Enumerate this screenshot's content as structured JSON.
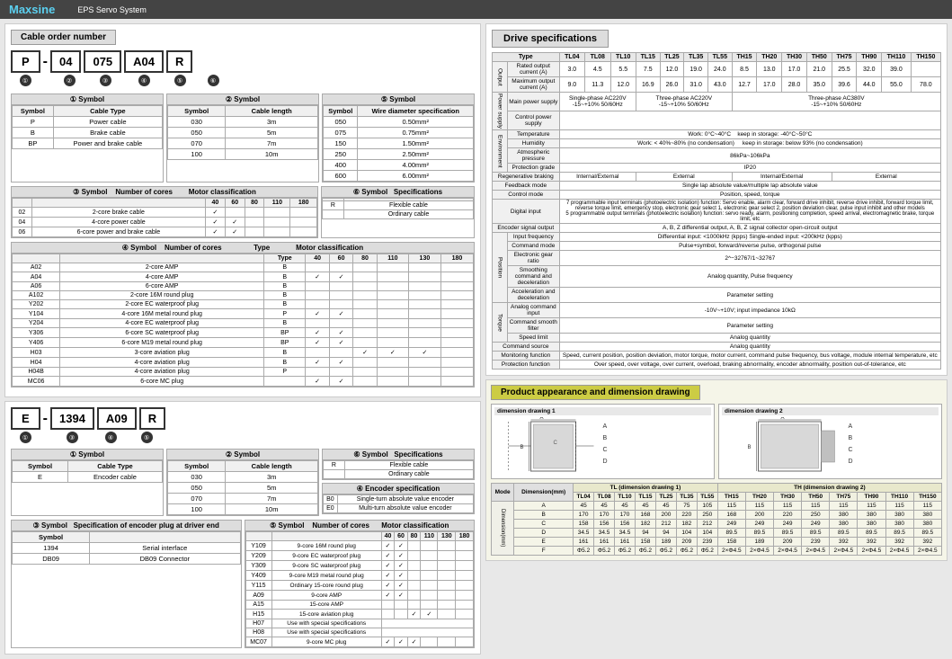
{
  "header": {
    "logo": "Maxsine",
    "system": "EPS Servo System"
  },
  "cable_order": {
    "title": "Cable order number",
    "code1": {
      "parts": [
        "P",
        "-",
        "04",
        "075",
        "A04",
        "R"
      ],
      "numbers": [
        "①",
        "②",
        "③",
        "④",
        "⑤",
        "⑥"
      ]
    },
    "code2": {
      "parts": [
        "E",
        "-",
        "1394",
        "A09",
        "R"
      ],
      "numbers": [
        "①",
        "②",
        "③",
        "④",
        "⑤"
      ]
    }
  },
  "drive_spec": {
    "title": "Drive specifications",
    "type_row": [
      "Type",
      "TL04",
      "TL08",
      "TL10",
      "TL15",
      "TL25",
      "TL35",
      "TL55",
      "TH15",
      "TH20",
      "TH30",
      "TH50",
      "TH75",
      "TH90",
      "TH110",
      "TH150"
    ],
    "rated_output": {
      "label": "Rated output current (A)",
      "values": [
        "3.0",
        "4.5",
        "5.5",
        "7.5",
        "12.0",
        "19.0",
        "24.0",
        "8.5",
        "13.0",
        "17.0",
        "21.0",
        "25.5",
        "32.0",
        "39.0",
        ""
      ]
    },
    "max_output": {
      "label": "Maximum output current (A)",
      "values": [
        "9.0",
        "11.3",
        "12.0",
        "16.9",
        "26.0",
        "31.0",
        "43.0",
        "12.7",
        "17.0",
        "28.0",
        "35.0",
        "39.6",
        "44.0",
        "55.0",
        "78.0"
      ]
    },
    "power_supply": {
      "label": "Main power supply",
      "single": "Single-phase AC220V -15~+10% 50/60Hz",
      "three_low": "Three-phase AC220V -15~+10% 50/60Hz",
      "three_high": "Three-phase AC380V -15~+10% 50/60Hz"
    },
    "environment": {
      "temp": "Work: 0°C~40°C   keep in storage: -40°C~50°C",
      "humidity": "Work: < 40%~80% (no condensation)   keep in storage: below 93% (no condensation)",
      "pressure": "86kPa~106kPa",
      "protection_grade": "IP20"
    },
    "braking": {
      "regenerative": "Internal/External",
      "external": "External",
      "internal_external": "Internal/External",
      "external2": "External"
    },
    "feedback": "Single lap absolute value/multiple lap absolute value",
    "control": "Position, speed, torque",
    "digital_input_1": "7 programmable input terminals (photoelectric isolation) function: Servo enable, alarm clear, forward drive inhibit, reverse drive inhibit, forward torque limit, reverse torque limit, emergency stop, electronic gear select 1, electronic gear select 2, position deviation clear, pulse input inhibit and other models",
    "digital_input_2": "5 programmable output terminals (photoelectric isolation) function: servo ready, alarm, positioning completion, speed arrival, electromagnetic brake, torque limit, etc",
    "encoder_output": "A, B, Z differential output, A, B, Z signal collector open-circuit output",
    "input_freq": "Differential input: <1000kHz (kpps)  Single-ended input: <200kHz (kpps)",
    "command_mode": "Pulse+symbol, forward/reverse pulse, orthogonal pulse",
    "elect_gear": "2^−32767/1~32767",
    "smoothing": "Analog quantity, Pulse frequency",
    "accel_decel": "Parameter setting",
    "analog_cmd": "-10V~+10V; input impedance 10kΩ",
    "analog_smooth": "Parameter setting",
    "speed_limit": "Analog quantity",
    "monitoring": "Speed, current position, position deviation, motor torque, motor current, command pulse frequency, bus voltage, module internal temperature, etc",
    "protection": "Over speed, over voltage, over current, overload, braking abnormality, encoder abnormality, position out-of-tolerance, etc"
  },
  "left_symbols": {
    "section1_title": "Symbol",
    "cable_type": {
      "label": "Cable Type",
      "rows": [
        {
          "sym": "P",
          "desc": "Power cable"
        },
        {
          "sym": "B",
          "desc": "Brake cable"
        },
        {
          "sym": "BP",
          "desc": "Power and brake cable"
        }
      ]
    },
    "cable_length": {
      "label": "Cable length",
      "rows": [
        {
          "sym": "030",
          "len": "3m"
        },
        {
          "sym": "050",
          "len": "5m"
        },
        {
          "sym": "070",
          "len": "7m"
        },
        {
          "sym": "100",
          "len": "10m"
        }
      ]
    },
    "num_cores_p": {
      "label": "Number of cores",
      "cols": [
        "40",
        "60",
        "80",
        "110",
        "180"
      ],
      "rows": [
        {
          "sym": "02",
          "desc": "2-core brake cable",
          "checks": [
            true,
            false,
            false,
            false,
            false
          ]
        },
        {
          "sym": "04",
          "desc": "4-core power cable",
          "checks": [
            true,
            true,
            false,
            false,
            false
          ]
        },
        {
          "sym": "06",
          "desc": "6-core power and brake cable",
          "checks": [
            true,
            true,
            false,
            false,
            false
          ]
        }
      ]
    },
    "wire_diam": {
      "label": "Wire diameter specification",
      "rows": [
        {
          "sym": "050",
          "spec": "0.50mm²"
        },
        {
          "sym": "075",
          "spec": "0.75mm²"
        },
        {
          "sym": "150",
          "spec": "1.50mm²"
        },
        {
          "sym": "250",
          "spec": "2.50mm²"
        },
        {
          "sym": "400",
          "spec": "4.00mm²"
        },
        {
          "sym": "600",
          "spec": "6.00mm²"
        }
      ]
    },
    "motor_connectors_p": {
      "label": "Number of cores",
      "type_cols": [
        "40",
        "60",
        "80",
        "110",
        "130",
        "180"
      ],
      "rows_p": [
        {
          "sym": "A02",
          "desc": "2-core AMP",
          "type": "B",
          "checks": [
            false,
            false,
            false,
            false,
            false,
            false
          ]
        },
        {
          "sym": "A04",
          "desc": "4-core AMP",
          "type": "B",
          "checks": [
            true,
            true,
            false,
            false,
            false,
            false
          ]
        },
        {
          "sym": "A06",
          "desc": "6-core AMP",
          "type": "B",
          "checks": [
            false,
            false,
            false,
            false,
            false,
            false
          ]
        },
        {
          "sym": "A102",
          "desc": "2-core 16M round plug",
          "type": "B",
          "checks": [
            false,
            false,
            false,
            false,
            false,
            false
          ]
        },
        {
          "sym": "Y202",
          "desc": "2-core EC waterproof plug",
          "type": "B",
          "checks": [
            false,
            false,
            false,
            false,
            false,
            false
          ]
        },
        {
          "sym": "Y104",
          "desc": "4-core 16M metal round plug",
          "type": "P",
          "checks": [
            true,
            true,
            false,
            false,
            false,
            false
          ]
        },
        {
          "sym": "Y204",
          "desc": "4-core EC waterproof plug",
          "type": "B",
          "checks": [
            false,
            false,
            false,
            false,
            false,
            false
          ]
        },
        {
          "sym": "Y306",
          "desc": "6-core SC waterproof plug",
          "type": "BP",
          "checks": [
            true,
            true,
            false,
            false,
            false,
            false
          ]
        },
        {
          "sym": "Y406",
          "desc": "6-core M19 metal round plug",
          "type": "BP",
          "checks": [
            true,
            true,
            false,
            false,
            false,
            false
          ]
        },
        {
          "sym": "H03",
          "desc": "3-core aviation plug",
          "type": "B",
          "checks": [
            false,
            false,
            false,
            false,
            false,
            false
          ]
        },
        {
          "sym": "H04",
          "desc": "4-core aviation plug",
          "type": "B",
          "checks": [
            true,
            true,
            false,
            false,
            false,
            false
          ]
        },
        {
          "sym": "H04B",
          "desc": "4-core aviation plug",
          "type": "P",
          "checks": [
            false,
            false,
            false,
            false,
            false,
            false
          ]
        },
        {
          "sym": "MC06",
          "desc": "6-core MC plug",
          "type": "",
          "checks": [
            true,
            true,
            false,
            false,
            false,
            false
          ]
        }
      ]
    },
    "specs": {
      "label": "Specifications",
      "rows": [
        {
          "sym": "R",
          "desc": "Flexible cable"
        },
        {
          "sym": "",
          "desc": "Ordinary cable"
        }
      ]
    },
    "encoder_cable": {
      "cable_type_label": "Cable Type",
      "e_row": {
        "sym": "E",
        "desc": "Encoder cable"
      },
      "length_label": "Cable length",
      "length_rows": [
        {
          "sym": "030",
          "len": "3m"
        },
        {
          "sym": "050",
          "len": "5m"
        },
        {
          "sym": "070",
          "len": "7m"
        },
        {
          "sym": "100",
          "len": "10m"
        }
      ],
      "encoder_plug_label": "Specification of encoder plug at driver end",
      "encoder_plug_rows": [
        {
          "sym": "1394",
          "desc": "Serial interface"
        },
        {
          "sym": "DB09",
          "desc": "DB09 Connector"
        }
      ],
      "encoder_spec_label": "Encoder specification",
      "encoder_spec_rows": [
        {
          "sym": "B0",
          "desc": "Single-turn absolute value encoder"
        },
        {
          "sym": "E0",
          "desc": "Multi-turn absolute value encoder"
        }
      ]
    },
    "encoder_cores": {
      "label": "Number of cores",
      "type_cols": [
        "40",
        "60",
        "80",
        "110",
        "130",
        "180"
      ],
      "rows": [
        {
          "sym": "Y109",
          "desc": "9-core 16M round plug",
          "checks": [
            true,
            true,
            false,
            false,
            false,
            false
          ]
        },
        {
          "sym": "Y209",
          "desc": "9-core EC waterproof plug",
          "checks": [
            true,
            true,
            false,
            false,
            false,
            false
          ]
        },
        {
          "sym": "Y309",
          "desc": "9-core SC waterproof plug",
          "checks": [
            true,
            true,
            false,
            false,
            false,
            false
          ]
        },
        {
          "sym": "Y409",
          "desc": "9-core M19 metal round plug",
          "checks": [
            true,
            true,
            false,
            false,
            false,
            false
          ]
        },
        {
          "sym": "Y115",
          "desc": "Ordinary 15-core round plug",
          "checks": [
            true,
            true,
            false,
            false,
            false,
            false
          ]
        },
        {
          "sym": "A09",
          "desc": "9-core AMP",
          "checks": [
            true,
            true,
            false,
            false,
            false,
            false
          ]
        },
        {
          "sym": "A15",
          "desc": "15-core AMP",
          "checks": [
            false,
            false,
            false,
            false,
            false,
            false
          ]
        },
        {
          "sym": "H15",
          "desc": "15-core aviation plug",
          "checks": [
            false,
            false,
            true,
            true,
            false,
            false
          ]
        },
        {
          "sym": "H07",
          "desc": "Use with special specifications",
          "checks": []
        },
        {
          "sym": "H08",
          "desc": "Use with special specifications",
          "checks": []
        },
        {
          "sym": "MC07",
          "desc": "9-core MC plug",
          "checks": [
            true,
            true,
            true,
            false,
            false,
            false
          ]
        }
      ]
    }
  },
  "product_appearance": {
    "title": "Product appearance and dimension drawing",
    "drawing1_label": "dimension drawing 1",
    "drawing2_label": "dimension drawing 2",
    "mode_label": "Mode",
    "tl_label": "TL (dimension drawing 1)",
    "th_label": "TH (dimension drawing 2)",
    "dim_rows": [
      "A",
      "B",
      "C",
      "D",
      "E",
      "F"
    ],
    "tl_cols": [
      "TL04",
      "TL08",
      "TL10",
      "TL15",
      "TL25",
      "TL35",
      "TL55",
      "TH15",
      "TH20",
      "TH30",
      "TH50",
      "TH75",
      "TH90",
      "TH110",
      "TH150"
    ],
    "dimensions_label": "Dimension(mm)",
    "dim_data": {
      "A": {
        "tl": [
          "45",
          "45",
          "45",
          "45",
          "45",
          "75",
          "105",
          "115",
          "115",
          "115",
          "115",
          "115",
          "115",
          "115",
          "115"
        ],
        "th": []
      },
      "B": {
        "tl": [
          "170",
          "170",
          "170",
          "168",
          "200",
          "220",
          "250",
          "168",
          "200",
          "220",
          "250",
          "380",
          "380",
          "380",
          "380"
        ]
      },
      "C": {
        "tl": [
          "158",
          "156",
          "156",
          "182",
          "212",
          "182",
          "212",
          "249",
          "249",
          "249",
          "249",
          "380",
          "380",
          "380",
          "380"
        ]
      },
      "D": {
        "tl": [
          "34.5",
          "34.5",
          "34.5",
          "94",
          "94",
          "104",
          "104",
          "89.5",
          "89.5",
          "89.5",
          "89.5",
          "89.5",
          "89.5",
          "89.5",
          "89.5"
        ]
      },
      "E": {
        "tl": [
          "161",
          "161",
          "161",
          "158",
          "189",
          "209",
          "239",
          "158",
          "189",
          "209",
          "239",
          "392",
          "392",
          "392",
          "392"
        ]
      },
      "F": {
        "tl": [
          "Φ5.2",
          "",
          "",
          "",
          "Φ5.2",
          "",
          "",
          "2×Φ4.5",
          "",
          "",
          "",
          "",
          "",
          "",
          ""
        ]
      }
    }
  }
}
